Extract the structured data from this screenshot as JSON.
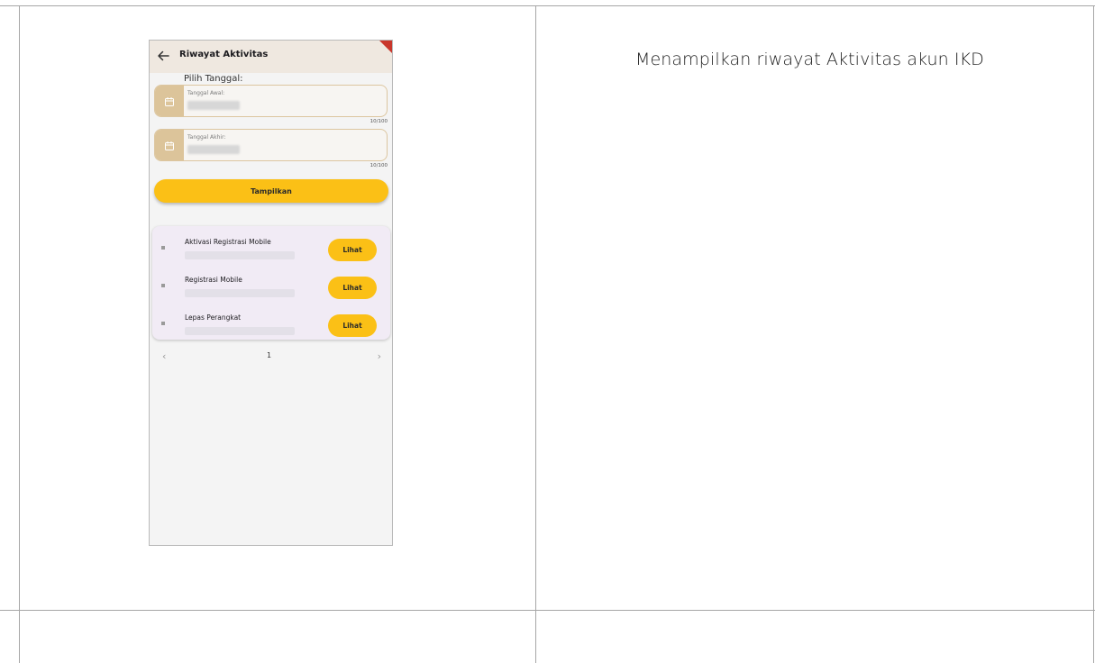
{
  "description": "Menampilkan riwayat Aktivitas akun IKD",
  "screen": {
    "title": "Riwayat Aktivitas",
    "pick_date_label": "Pilih Tanggal:",
    "start_date": {
      "label": "Tanggal Awal:",
      "counter": "10/100"
    },
    "end_date": {
      "label": "Tanggal Akhir:",
      "counter": "10/100"
    },
    "show_button": "Tampilkan",
    "activities": [
      {
        "title": "Aktivasi Registrasi Mobile",
        "action": "Lihat"
      },
      {
        "title": "Registrasi Mobile",
        "action": "Lihat"
      },
      {
        "title": "Lepas Perangkat",
        "action": "Lihat"
      }
    ],
    "pagination": {
      "prev": "‹",
      "page": "1",
      "next": "›"
    }
  },
  "colors": {
    "accent": "#fbc016",
    "appbar": "#efe8e0",
    "field_prefix": "#dcc49a",
    "card": "#f1ebf5",
    "corner_flag": "#c9362b"
  },
  "icons": {
    "back": "arrow-left-icon",
    "calendar": "calendar-icon"
  }
}
